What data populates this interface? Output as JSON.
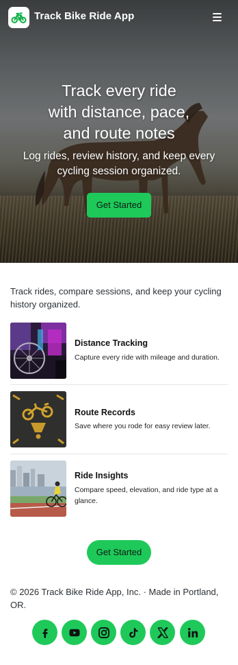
{
  "header": {
    "app_name": "Track Bike Ride App",
    "logo_icon": "bicycle-icon",
    "menu_icon": "hamburger-menu-icon"
  },
  "hero": {
    "title_line1": "Track every ride",
    "title_line2": "with distance, pace,",
    "title_line3": "and route notes",
    "subtitle": "Log rides, review history, and keep every cycling session organized.",
    "cta_label": "Get Started"
  },
  "intro": {
    "text": "Track rides, compare sessions, and keep your cycling history organized."
  },
  "features": [
    {
      "title": "Distance Tracking",
      "description": "Capture every ride with mileage and duration.",
      "image": "bike-wheel-neon-photo"
    },
    {
      "title": "Route Records",
      "description": "Save where you rode for easy review later.",
      "image": "bike-lane-marking-photo"
    },
    {
      "title": "Ride Insights",
      "description": "Compare speed, elevation, and ride type at a glance.",
      "image": "cyclist-city-path-photo"
    }
  ],
  "bottom_cta": {
    "label": "Get Started"
  },
  "footer": {
    "text": "© 2026 Track Bike Ride App, Inc. · Made in Portland, OR.",
    "socials": [
      {
        "name": "facebook",
        "icon": "facebook-icon"
      },
      {
        "name": "youtube",
        "icon": "youtube-icon"
      },
      {
        "name": "instagram",
        "icon": "instagram-icon"
      },
      {
        "name": "tiktok",
        "icon": "tiktok-icon"
      },
      {
        "name": "x",
        "icon": "x-icon"
      },
      {
        "name": "linkedin",
        "icon": "linkedin-icon"
      }
    ]
  },
  "colors": {
    "accent": "#1ec95a",
    "text": "#2b3035",
    "divider": "#e2e4e7"
  }
}
